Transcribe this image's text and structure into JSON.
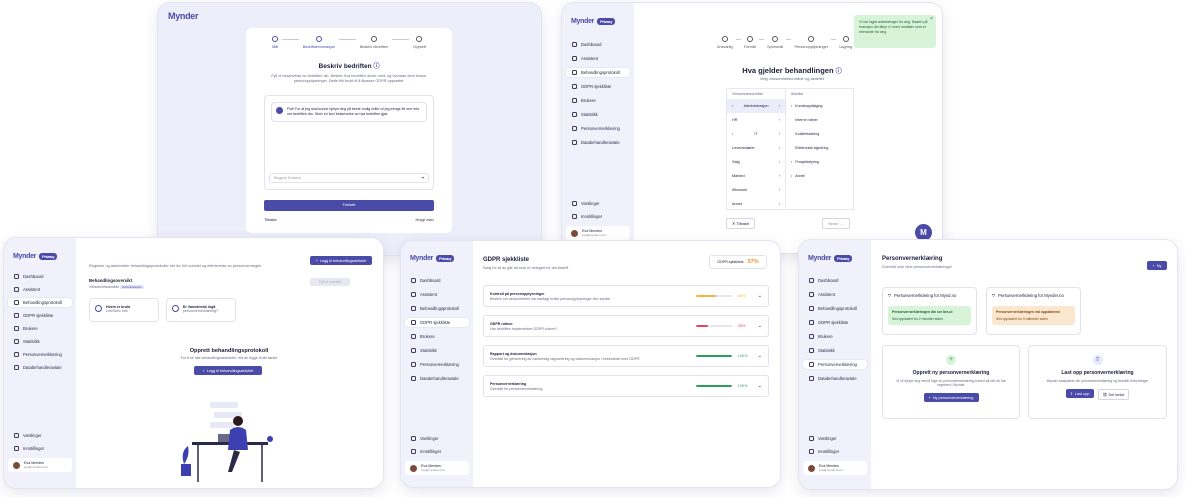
{
  "brand": {
    "name": "Mynder",
    "tag": "Privacy"
  },
  "screen1": {
    "steps": [
      "Mål",
      "Bedriftsinformasjon",
      "Beskriv bedriften",
      "Oppsett"
    ],
    "title": "Beskriv bedriften",
    "subtitle": "Fyll ut beskrivelse av bedriften din. Beskriv hva bedriften driver med, og hvordan dere bruker personopplysninger. Dette blir brukt til å tilpasse GDPR-oppsettet.",
    "chat_message": "Fint! For at jeg skal kunne hjelpe deg på beste mulig måte vil jeg trenge litt mer info om bedriften din. Skriv en kort beskrivelse av hva bedriften gjør.",
    "input_placeholder": "Begynn å skrive",
    "continue_label": "Fortsett",
    "back_label": "Tilbake",
    "skip_label": "Hopp over"
  },
  "screen2": {
    "steps": [
      "Ansvarlig",
      "Formål",
      "Sporsmål",
      "Personopplysninger",
      "Lagring"
    ],
    "toast": "Vi har laget anbefalinger for deg. Basert på bransjen din tilbyr vi noen områder som er relevante for deg.",
    "title": "Hva gjelder behandlingen",
    "subtitle": "Velg virksomhetsområde og aktivitet",
    "left_header": "Virksomhetsområde",
    "right_header": "Aktivitet",
    "areas": [
      "Administrasjon",
      "HR",
      "IT",
      "Leverandører",
      "Salg",
      "Marked",
      "Økonomi",
      "Annet"
    ],
    "activities": [
      "Kundeoppfølging",
      "Interne rutiner",
      "Kvalitetssikring",
      "Elektronisk signering",
      "Prosjektstyring",
      "Annet"
    ],
    "back_label": "Tilbake",
    "next_label": "Neste",
    "nav": [
      "Dashboard",
      "Assistent",
      "Behandlingsprotokoll",
      "GDPR sjekkliste",
      "Brukere",
      "Statistikk",
      "Personvernerklæring",
      "Databehandleravtale"
    ],
    "bottom_nav": [
      "Varslinger",
      "Innstillinger"
    ],
    "user_name": "Eva Mendes",
    "user_email": "eva@mynder.com"
  },
  "screen3": {
    "intro": "Registrer og administrer behandlingsprotokoller her for full oversikt og etterlevelse av personvernregler",
    "add_label": "Legg til behandlingsaktivitet",
    "section_title": "Behandlingsoversikt",
    "section_sub": "Virksomhetsområde",
    "badge": "Administrasjon",
    "filter_label": "Fyll ut oversikt",
    "cards": [
      {
        "title": "Hvem er brukt",
        "sub": "Les/Skriv info"
      },
      {
        "title": "Er Vanedtrekk ingå",
        "sub": "personvernerklæring?"
      }
    ],
    "empty_title": "Opprett behandlingsprotokoll",
    "empty_sub": "For å se alle behandlingsaktiviteter, må du legge til din første",
    "empty_button": "Legg til behandlingsaktivitet"
  },
  "screen4": {
    "title": "GDPR sjekkliste",
    "subtitle": "Sørg for at du går alt som er delegert for din bedrift",
    "score_label": "GDPR-sjekkliste",
    "score": "57%",
    "items": [
      {
        "title": "Kontroll på personopplysninger",
        "desc": "Beskriv om virksomheten har kartlagt hvilke personopplysninger den samler",
        "percent": "56%",
        "value": 56,
        "color": "#f4b63c"
      },
      {
        "title": "GDPR rutiner",
        "desc": "Har bedriften implementert GDPR-rutiner?",
        "percent": "35%",
        "value": 35,
        "color": "#e9435f"
      },
      {
        "title": "Rapport og dokumentasjon",
        "desc": "Oversikt for generering av nødvendig rapportering og dokumentasjon i forbindelse med GDPR",
        "percent": "100%",
        "value": 100,
        "color": "#2e9e5e"
      },
      {
        "title": "Personvernerklæring",
        "desc": "Oversikt for personvernerklæring",
        "percent": "100%",
        "value": 100,
        "color": "#2e9e5e"
      }
    ]
  },
  "screen5": {
    "title": "Personvernerklæring",
    "subtitle": "Oversikt over dine personvernerklæringer",
    "add_label": "Ny",
    "policies": [
      {
        "title": "Personvernerklæring for Mynd.no",
        "status": "Personvernerklæringen din ser bra ut",
        "note": "Sist oppdatert for 2 minutter siden",
        "kind": "ok"
      },
      {
        "title": "Personvernerklæring for Mynder.no",
        "status": "Personvernerklæringen må oppdateres!",
        "note": "Sist oppdatert for 3 måneder siden",
        "kind": "warn"
      }
    ],
    "create_title": "Opprett ny personvernerklæring",
    "create_sub": "Vi vil hjelpe deg med å lage en personvernerklæring basert på det du har registrert i Mynder",
    "create_button": "Ny personvernerklæring",
    "upload_title": "Last opp personvernerklæring",
    "upload_sub": "Mynder analyserer din personvernerklæring og foreslår forbedringer",
    "upload_button": "Last opp",
    "share_button": "Del lenke"
  }
}
